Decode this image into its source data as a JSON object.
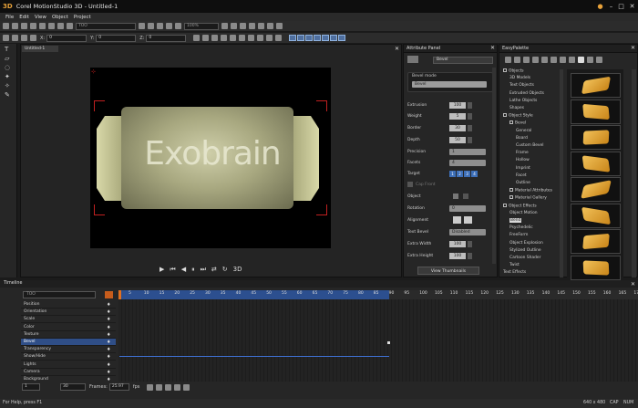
{
  "titlebar": {
    "app_logo": "3D",
    "title": "Corel MotionStudio 3D - Untitled-1"
  },
  "menu": [
    "File",
    "Edit",
    "View",
    "Object",
    "Project"
  ],
  "toolbar2": {
    "x_label": "X:",
    "x_value": "0",
    "y_label": "Y:",
    "y_value": "0",
    "z_label": "Z:",
    "z_value": "0",
    "preset_select": "TOO",
    "zoom_select": "100%"
  },
  "viewport": {
    "tab_label": "Untitled-1",
    "object_text": "Exobrain",
    "play_controls_label": "3D"
  },
  "attribute_panel": {
    "title": "Attribute Panel",
    "type_select": "Bevel",
    "bevel_mode_label": "Bevel mode",
    "bevel_mode_value": "Bevel",
    "fields": [
      {
        "label": "Extrusion",
        "value": "100"
      },
      {
        "label": "Weight",
        "value": "5"
      },
      {
        "label": "Border",
        "value": "30"
      },
      {
        "label": "Depth",
        "value": "50"
      },
      {
        "label": "Precision",
        "value": "1"
      },
      {
        "label": "Facets",
        "value": "4"
      }
    ],
    "target_label": "Target",
    "target_values": [
      "1",
      "2",
      "3",
      "4"
    ],
    "cap_label": "Cap Front",
    "object_label": "Object",
    "rotation_label": "Rotation",
    "rotation_value": "0",
    "alignment_label": "Alignment",
    "text_bevel_label": "Text Bevel",
    "text_bevel_value": "Disabled",
    "extra_width_label": "Extra Width",
    "extra_width_value": "100",
    "extra_height_label": "Extra Height",
    "extra_height_value": "100",
    "view_thumbnails": "View Thumbnails"
  },
  "easy_palette": {
    "title": "EasyPalette",
    "tree": [
      {
        "label": "Objects",
        "level": 0,
        "box": true
      },
      {
        "label": "3D Models",
        "level": 1
      },
      {
        "label": "Text Objects",
        "level": 1
      },
      {
        "label": "Extruded Objects",
        "level": 1
      },
      {
        "label": "Lathe Objects",
        "level": 1
      },
      {
        "label": "Shapes",
        "level": 1
      },
      {
        "label": "Object Style",
        "level": 0,
        "box": true
      },
      {
        "label": "Bevel",
        "level": 1,
        "box": true
      },
      {
        "label": "General",
        "level": 2
      },
      {
        "label": "Board",
        "level": 2
      },
      {
        "label": "Custom Bevel",
        "level": 2
      },
      {
        "label": "Frame",
        "level": 2
      },
      {
        "label": "Hollow",
        "level": 2
      },
      {
        "label": "Imprint",
        "level": 2
      },
      {
        "label": "Facet",
        "level": 2
      },
      {
        "label": "Outline",
        "level": 2
      },
      {
        "label": "Material Attributes",
        "level": 1,
        "box": true
      },
      {
        "label": "Material Gallery",
        "level": 1,
        "box": true
      },
      {
        "label": "Object Effects",
        "level": 0,
        "box": true
      },
      {
        "label": "Object Motion",
        "level": 1
      },
      {
        "label": "Bend",
        "level": 1,
        "selected": true
      },
      {
        "label": "Psychedelic",
        "level": 1
      },
      {
        "label": "FreeForm",
        "level": 1
      },
      {
        "label": "Object Explosion",
        "level": 1
      },
      {
        "label": "Stylized Outline",
        "level": 1
      },
      {
        "label": "Cartoon Shader",
        "level": 1
      },
      {
        "label": "Twist",
        "level": 1
      },
      {
        "label": "Text Effects",
        "level": 0
      }
    ]
  },
  "timeline": {
    "title": "Timeline",
    "preset": "TOO",
    "ticks": [
      "5",
      "10",
      "15",
      "20",
      "25",
      "30",
      "35",
      "40",
      "45",
      "50",
      "55",
      "60",
      "65",
      "70",
      "75",
      "80",
      "85",
      "90",
      "95",
      "100",
      "105",
      "110",
      "115",
      "120",
      "125",
      "130",
      "135",
      "140",
      "145",
      "150",
      "155",
      "160",
      "165",
      "170"
    ],
    "tracks": [
      {
        "label": "Position"
      },
      {
        "label": "Orientation"
      },
      {
        "label": "Scale"
      },
      {
        "label": "Color"
      },
      {
        "label": "Texture"
      },
      {
        "label": "Bevel",
        "selected": true
      },
      {
        "label": "Transparency"
      },
      {
        "label": "Show/Hide"
      },
      {
        "label": "Lights"
      },
      {
        "label": "Camera"
      },
      {
        "label": "Background"
      }
    ],
    "frame_current": "1",
    "frame_total": "30",
    "frames_label": "Frames:",
    "duration_value": "25.97",
    "fps_label": "fps"
  },
  "status": {
    "help": "For Help, press F1",
    "dims": "640 x 480",
    "cap": "CAP",
    "num": "NUM"
  }
}
